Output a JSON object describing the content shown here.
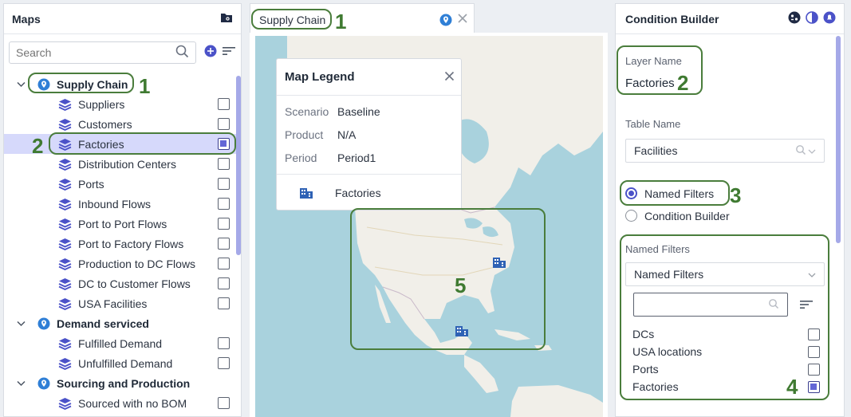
{
  "maps_panel": {
    "title": "Maps",
    "search_placeholder": "Search",
    "tree": [
      {
        "type": "group",
        "label": "Supply Chain"
      },
      {
        "type": "layer",
        "label": "Suppliers",
        "checked": false
      },
      {
        "type": "layer",
        "label": "Customers",
        "checked": false
      },
      {
        "type": "layer",
        "label": "Factories",
        "checked": true,
        "selected": true
      },
      {
        "type": "layer",
        "label": "Distribution Centers",
        "checked": false
      },
      {
        "type": "layer",
        "label": "Ports",
        "checked": false
      },
      {
        "type": "layer",
        "label": "Inbound Flows",
        "checked": false
      },
      {
        "type": "layer",
        "label": "Port to Port Flows",
        "checked": false
      },
      {
        "type": "layer",
        "label": "Port to Factory Flows",
        "checked": false
      },
      {
        "type": "layer",
        "label": "Production to DC Flows",
        "checked": false
      },
      {
        "type": "layer",
        "label": "DC to Customer Flows",
        "checked": false
      },
      {
        "type": "layer",
        "label": "USA Facilities",
        "checked": false
      },
      {
        "type": "group",
        "label": "Demand serviced"
      },
      {
        "type": "layer",
        "label": "Fulfilled Demand",
        "checked": false
      },
      {
        "type": "layer",
        "label": "Unfulfilled Demand",
        "checked": false
      },
      {
        "type": "group",
        "label": "Sourcing and Production"
      },
      {
        "type": "layer",
        "label": "Sourced with no BOM",
        "checked": false
      }
    ]
  },
  "map_tab": {
    "label": "Supply Chain"
  },
  "legend": {
    "title": "Map Legend",
    "rows": [
      {
        "key": "Scenario",
        "value": "Baseline"
      },
      {
        "key": "Product",
        "value": "N/A"
      },
      {
        "key": "Period",
        "value": "Period1"
      }
    ],
    "layer_label": "Factories"
  },
  "condition_builder": {
    "title": "Condition Builder",
    "layer_name_label": "Layer Name",
    "layer_name_value": "Factories",
    "table_name_label": "Table Name",
    "table_name_value": "Facilities",
    "radio_named_filters": "Named Filters",
    "radio_condition_builder": "Condition Builder",
    "named_filters_label": "Named Filters",
    "named_filters_select": "Named Filters",
    "filters": [
      {
        "label": "DCs",
        "checked": false
      },
      {
        "label": "USA locations",
        "checked": false
      },
      {
        "label": "Ports",
        "checked": false
      },
      {
        "label": "Factories",
        "checked": true
      }
    ]
  },
  "annotations": {
    "n1": "1",
    "n1b": "1",
    "n2": "2",
    "n2b": "2",
    "n3": "3",
    "n4": "4",
    "n5": "5"
  },
  "colors": {
    "accent": "#4b52c8",
    "selection": "#d6d9fb",
    "annotation": "#4a7d3c",
    "water": "#a9d2dd",
    "land": "#f1efe9"
  }
}
